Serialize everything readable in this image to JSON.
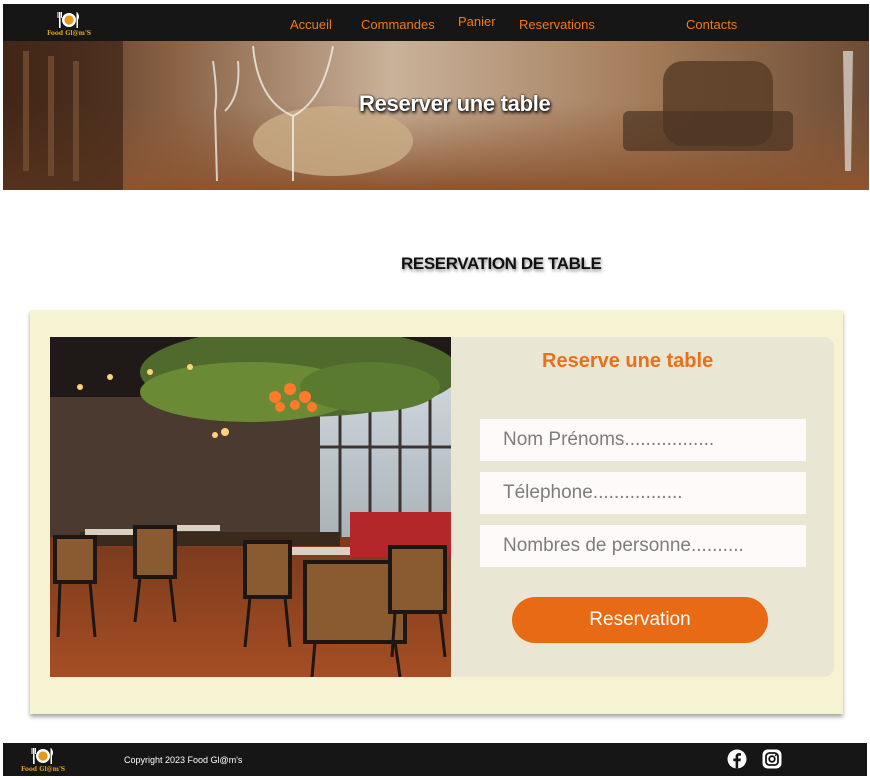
{
  "nav": {
    "brand": "Food Gl@m'S",
    "links": [
      "Accueil",
      "Commandes",
      "Panier",
      "Reservations",
      "Contacts"
    ]
  },
  "hero": {
    "title": "Reserver une  table"
  },
  "section": {
    "title": "RESERVATION DE TABLE"
  },
  "form": {
    "title": "Reserve une table",
    "name_placeholder": "Nom Prénoms.................",
    "phone_placeholder": "Télephone.................",
    "guests_placeholder": "Nombres de personne..........",
    "submit_label": "Reservation"
  },
  "footer": {
    "brand": "Food Gl@m'S",
    "copyright": "Copyright 2023  Food Gl@m's",
    "social_icons": [
      "facebook-icon",
      "instagram-icon"
    ]
  },
  "colors": {
    "accent": "#e86a14",
    "nav_background": "#161616",
    "card_background": "#f6f3d2",
    "form_panel": "#e9e6d3"
  }
}
